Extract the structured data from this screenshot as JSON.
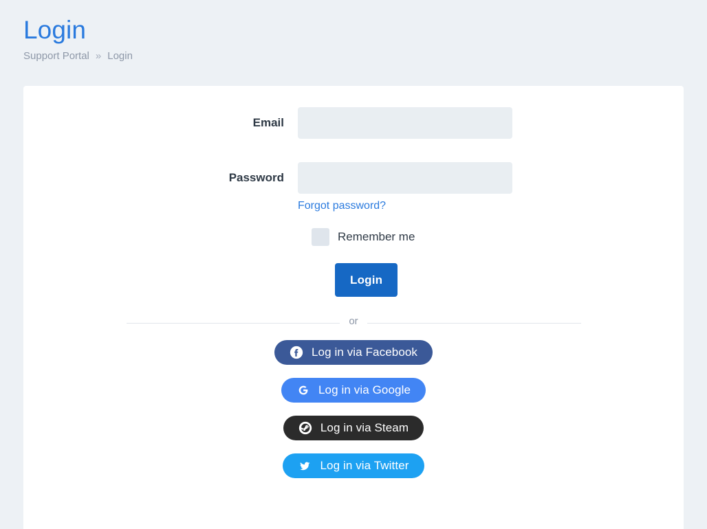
{
  "header": {
    "title": "Login",
    "breadcrumb": {
      "parent": "Support Portal",
      "separator": "»",
      "current": "Login"
    }
  },
  "form": {
    "email": {
      "label": "Email",
      "value": "",
      "placeholder": ""
    },
    "password": {
      "label": "Password",
      "value": "",
      "placeholder": ""
    },
    "forgot_password_label": "Forgot password?",
    "remember_me_label": "Remember me",
    "remember_me_checked": false,
    "submit_label": "Login"
  },
  "divider": {
    "text": "or"
  },
  "social": {
    "buttons": [
      {
        "label": "Log in via Facebook",
        "icon": "facebook-icon",
        "color": "#3b5998"
      },
      {
        "label": "Log in via Google",
        "icon": "google-icon",
        "color": "#4285f4"
      },
      {
        "label": "Log in via Steam",
        "icon": "steam-icon",
        "color": "#2b2b2b"
      },
      {
        "label": "Log in via Twitter",
        "icon": "twitter-icon",
        "color": "#1da1f2"
      }
    ]
  },
  "colors": {
    "page_background": "#edf1f5",
    "card_background": "#ffffff",
    "title": "#2a7ade",
    "link": "#2a7ade",
    "primary_button": "#1668c4",
    "input_fill": "#e9eef2",
    "muted_text": "#8e98a8"
  }
}
